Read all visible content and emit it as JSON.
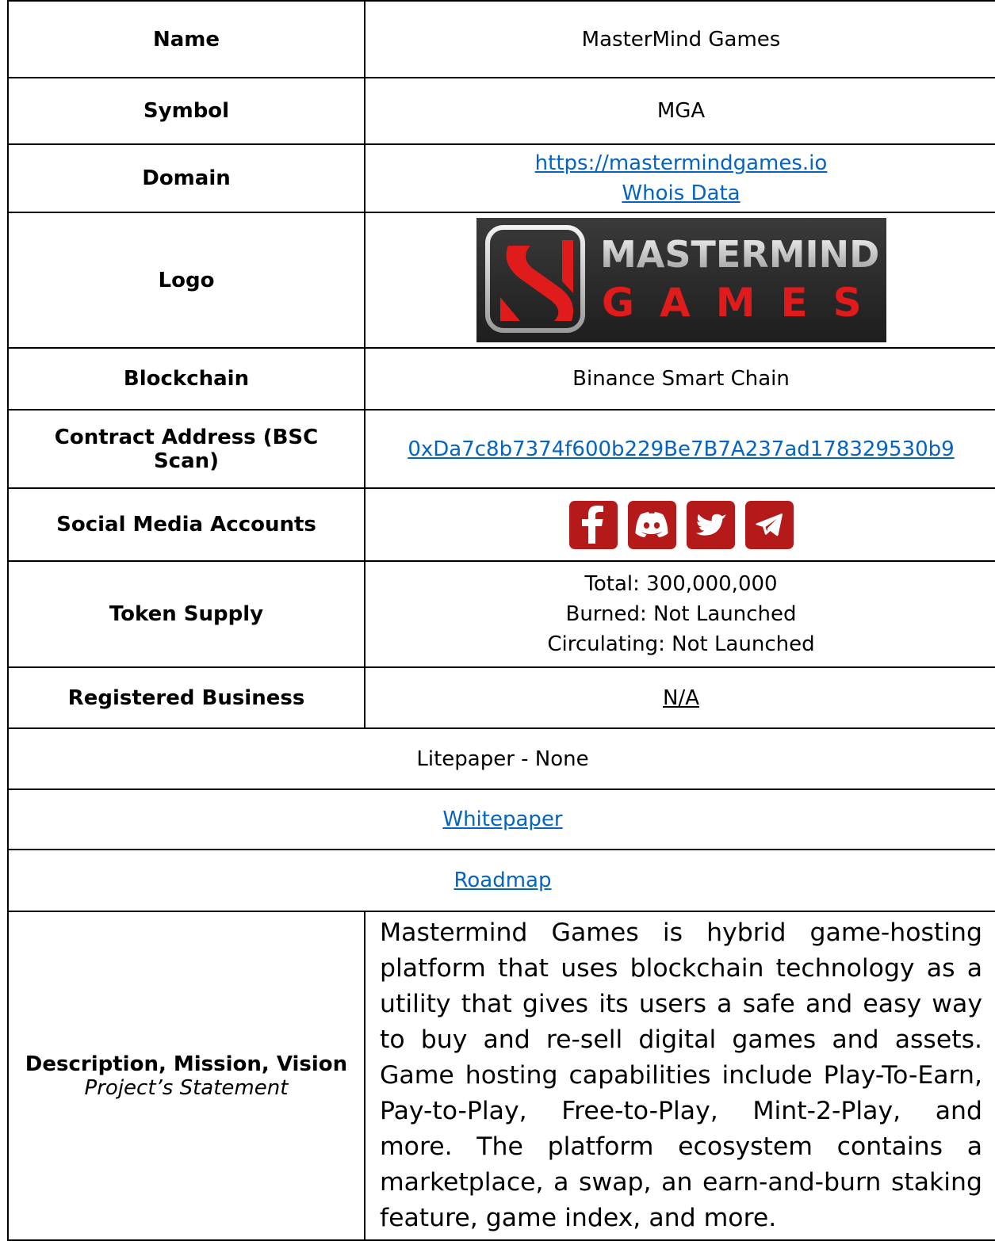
{
  "rows": {
    "name": {
      "label": "Name",
      "value": "MasterMind Games"
    },
    "symbol": {
      "label": "Symbol",
      "value": "MGA"
    },
    "domain": {
      "label": "Domain",
      "url": "https://mastermindgames.io",
      "whois": "Whois Data"
    },
    "logo": {
      "label": "Logo",
      "line1": "MASTERMIND",
      "line2": "GAMES"
    },
    "blockchain": {
      "label": "Blockchain",
      "value": "Binance Smart Chain"
    },
    "contract": {
      "label": "Contract Address (BSC Scan)",
      "value": "0xDa7c8b7374f600b229Be7B7A237ad178329530b9"
    },
    "social": {
      "label": "Social Media Accounts",
      "icons": [
        "facebook-icon",
        "discord-icon",
        "twitter-icon",
        "telegram-icon"
      ]
    },
    "supply": {
      "label": "Token Supply",
      "total": "Total: 300,000,000",
      "burned": "Burned: Not Launched",
      "circulating": "Circulating: Not Launched"
    },
    "business": {
      "label": "Registered Business",
      "value": "N/A"
    },
    "litepaper": {
      "value": "Litepaper - None"
    },
    "whitepaper": {
      "value": "Whitepaper"
    },
    "roadmap": {
      "value": "Roadmap"
    },
    "description": {
      "label": "Description, Mission, Vision",
      "sublabel": "Project’s Statement",
      "value": "Mastermind Games is hybrid game-hosting platform that uses blockchain technology as a utility that gives its users a safe and easy way to buy and re-sell digital games and assets. Game hosting capabilities include Play-To-Earn, Pay-to-Play, Free-to-Play, Mint-2-Play, and more. The platform ecosystem contains a marketplace, a swap, an earn-and-burn staking feature, game index, and more."
    }
  },
  "colors": {
    "link": "#0563c1",
    "social_bg": "#b51a1a",
    "logo_red": "#e01b1b"
  }
}
